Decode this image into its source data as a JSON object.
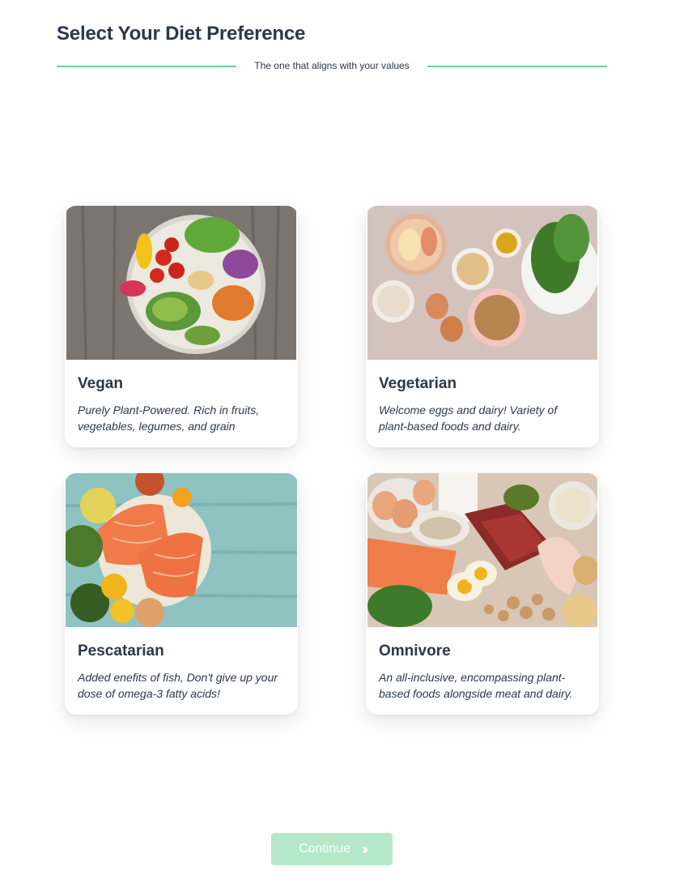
{
  "header": {
    "title": "Select Your Diet Preference",
    "subtitle": "The one that aligns with your values"
  },
  "cards": [
    {
      "name": "Vegan",
      "description": "Purely Plant-Powered. Rich in fruits, vegetables, legumes, and grain",
      "image": "vegan-bowl-image"
    },
    {
      "name": "Vegetarian",
      "description": "Welcome eggs and dairy! Variety of plant-based foods and dairy.",
      "image": "vegetarian-ingredients-image"
    },
    {
      "name": "Pescatarian",
      "description": "Added enefits of fish, Don't give up your dose of omega-3 fatty acids!",
      "image": "salmon-fillet-image"
    },
    {
      "name": "Omnivore",
      "description": "An all-inclusive, encompassing plant-based foods alongside meat and dairy.",
      "image": "meat-eggs-nuts-image"
    }
  ],
  "continue_button": {
    "label": "Continue",
    "icon": "double-chevron-right-icon"
  },
  "colors": {
    "accent": "#6fcf8f",
    "button_disabled": "#b5e8c8",
    "text": "#2d3748"
  }
}
